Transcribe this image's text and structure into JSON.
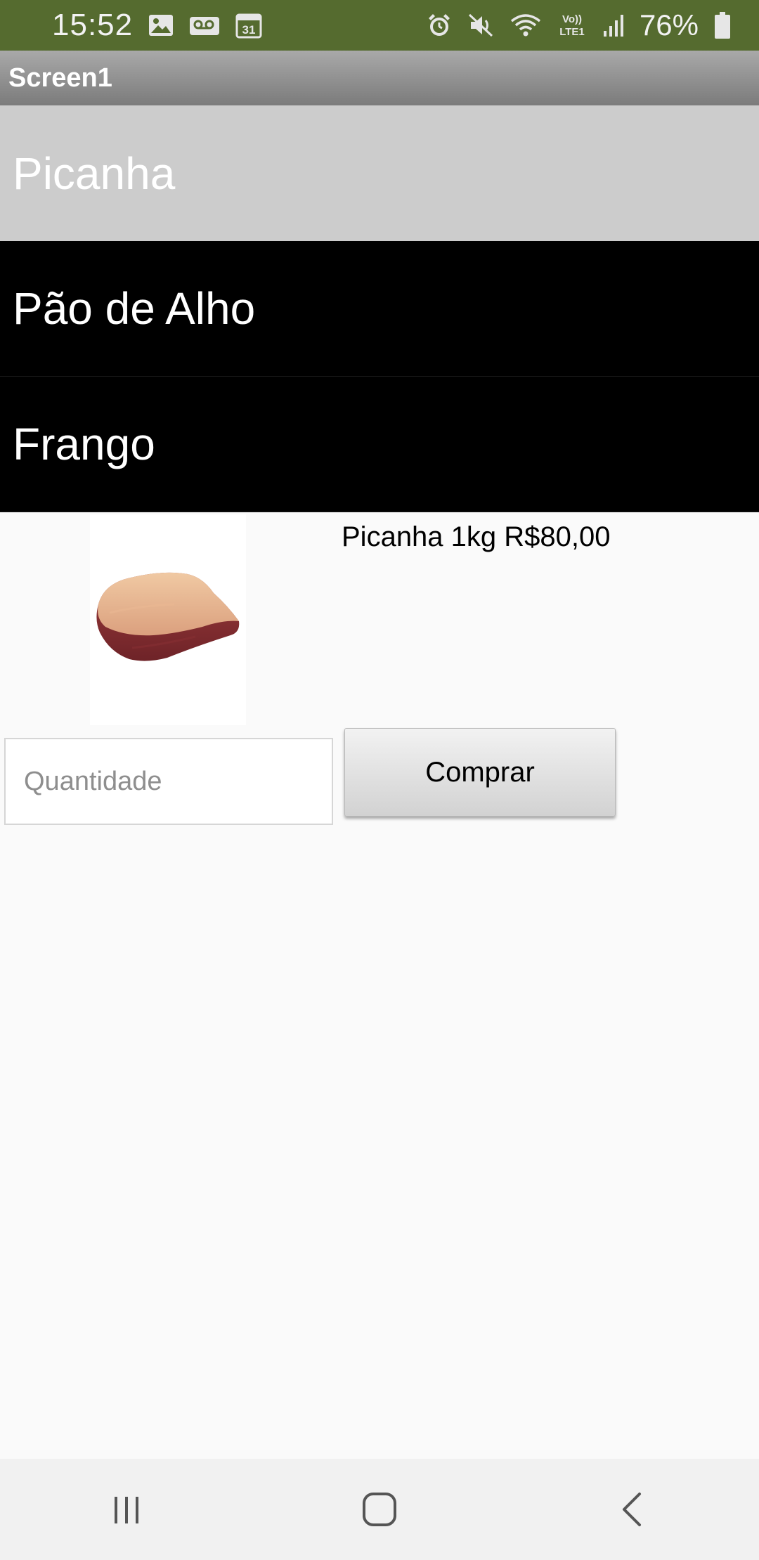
{
  "status_bar": {
    "time": "15:52",
    "battery": "76%",
    "icons_left": [
      "image-icon",
      "voicemail-icon",
      "calendar-icon"
    ],
    "calendar_day": "31",
    "icons_right": [
      "alarm-icon",
      "mute-icon",
      "wifi-icon",
      "volte-icon",
      "signal-icon",
      "battery-icon"
    ],
    "volte_label_top": "Vo))",
    "volte_label_bottom": "LTE1",
    "color": "#556b2f"
  },
  "title_bar": {
    "title": "Screen1"
  },
  "list": {
    "items": [
      {
        "label": "Picanha",
        "selected": true
      },
      {
        "label": "Pão de Alho",
        "selected": false
      },
      {
        "label": "Frango",
        "selected": false
      }
    ]
  },
  "product": {
    "image_icon": "picanha-meat-image",
    "label": "Picanha 1kg R$80,00"
  },
  "form": {
    "quantity_placeholder": "Quantidade",
    "quantity_value": "",
    "buy_label": "Comprar"
  },
  "nav_bar": {
    "icons": [
      "recent-apps-icon",
      "home-icon",
      "back-icon"
    ]
  }
}
